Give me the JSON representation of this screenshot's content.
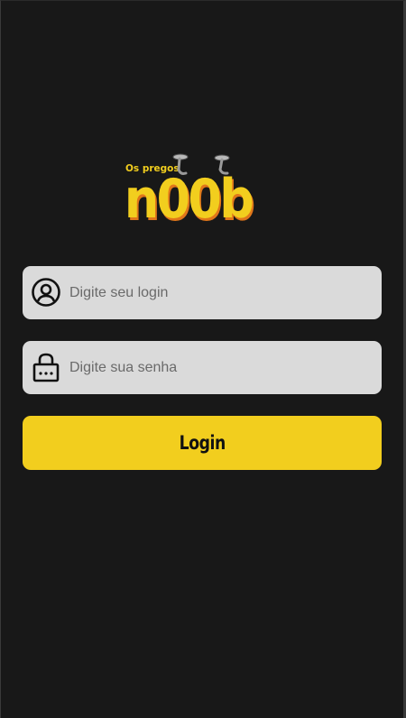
{
  "colors": {
    "background": "#181818",
    "field_background": "#dadada",
    "accent": "#f2ce1e",
    "logo_shadow": "#e0761a"
  },
  "logo": {
    "small_text": "Os pregos",
    "brand_text": "n00b"
  },
  "login_field": {
    "icon": "user-circle-icon",
    "placeholder": "Digite seu login",
    "value": ""
  },
  "password_field": {
    "icon": "lock-icon",
    "placeholder": "Digite sua senha",
    "value": ""
  },
  "login_button": {
    "label": "Login"
  }
}
